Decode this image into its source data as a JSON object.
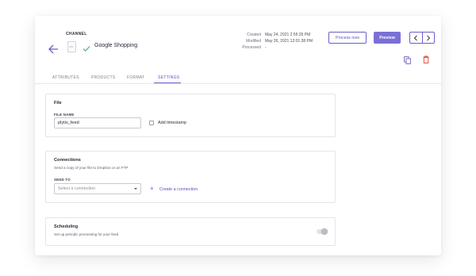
{
  "header": {
    "channel_label": "CHANNEL",
    "file_icon_text": "CSV",
    "channel_name": "Google Shopping",
    "meta": [
      {
        "key": "Created",
        "value": "May 24, 2021 2:55:35 PM"
      },
      {
        "key": "Modified",
        "value": "May 26, 2021 12:01:38 PM"
      },
      {
        "key": "Processed",
        "value": "-"
      }
    ],
    "process_label": "Process now",
    "preview_label": "Preview"
  },
  "tabs": [
    {
      "label": "ATTRIBUTES"
    },
    {
      "label": "PRODUCTS"
    },
    {
      "label": "FORMAT"
    },
    {
      "label": "SETTINGS"
    }
  ],
  "file_section": {
    "title": "File",
    "field_label": "FILE NAME",
    "file_name": "plytix_feed",
    "timestamp_label": "Add timestamp"
  },
  "connections_section": {
    "title": "Connections",
    "subtitle": "Send a copy of your file to Dropbox or an FTP",
    "field_label": "SEND TO",
    "select_placeholder": "Select a connection",
    "create_label": "Create a connection"
  },
  "scheduling_section": {
    "title": "Scheduling",
    "subtitle": "Set up periodic processing for your feed"
  },
  "colors": {
    "accent": "#6b5fc7",
    "preview_bg": "#7b6fd6",
    "check": "#3fb27f",
    "trash": "#e0412c"
  },
  "icons": [
    "back-arrow-icon",
    "file-icon",
    "check-icon",
    "chevron-left-icon",
    "chevron-right-icon",
    "copy-icon",
    "trash-icon",
    "plus-icon",
    "caret-down-icon"
  ]
}
